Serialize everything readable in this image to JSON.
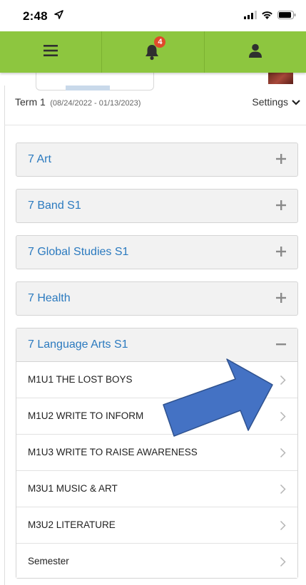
{
  "status_bar": {
    "time": "2:48",
    "icons": [
      "location-arrow-icon",
      "cellular-signal-icon",
      "wifi-icon",
      "battery-icon"
    ]
  },
  "nav": {
    "menu_icon": "hamburger-menu-icon",
    "notifications_icon": "bell-icon",
    "notification_count": "4",
    "profile_icon": "user-icon",
    "colors": {
      "bar": "#8dc63f",
      "badge": "#e0492b",
      "icon": "#2f2f2f"
    }
  },
  "term": {
    "label": "Term 1",
    "dates": "(08/24/2022 - 01/13/2023)",
    "settings_label": "Settings"
  },
  "courses": [
    {
      "name": "7 Art",
      "expanded": false
    },
    {
      "name": "7 Band S1",
      "expanded": false
    },
    {
      "name": "7 Global Studies S1",
      "expanded": false
    },
    {
      "name": "7 Health",
      "expanded": false
    },
    {
      "name": "7 Language Arts S1",
      "expanded": true
    }
  ],
  "units": [
    "M1U1 THE LOST BOYS",
    "M1U2 WRITE TO INFORM",
    "M1U3 WRITE TO RAISE AWARENESS",
    "M3U1 MUSIC & ART",
    "M3U2 LITERATURE",
    "Semester"
  ],
  "annotation": {
    "shape": "arrow",
    "color": "#4472c4",
    "outline": "#2f528f"
  },
  "colors": {
    "course_link": "#2b7abf"
  }
}
